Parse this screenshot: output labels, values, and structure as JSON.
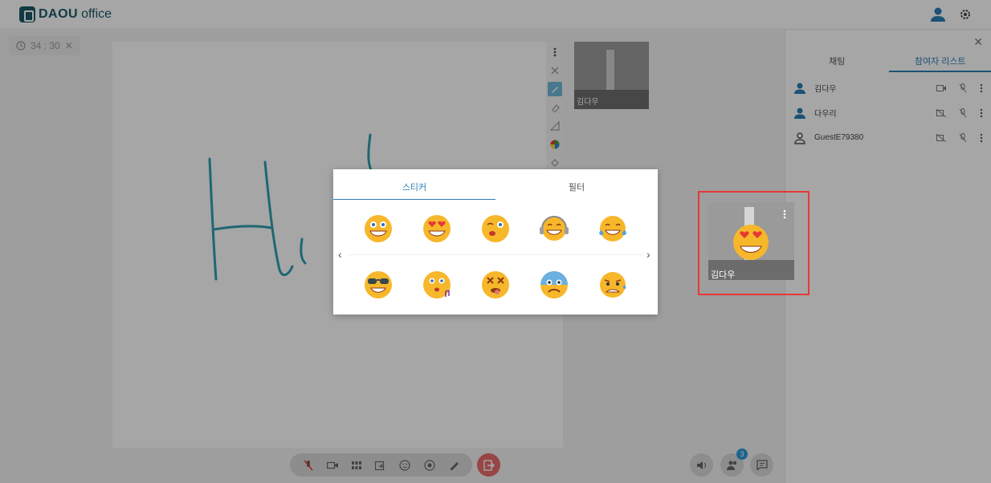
{
  "app": {
    "brand": "DAOU",
    "suffix": "office"
  },
  "timer": {
    "text": "34 : 30"
  },
  "board": {
    "handwriting": "Hi"
  },
  "thumbnail": {
    "name": "김다우"
  },
  "panel": {
    "tabs": [
      "채팅",
      "참여자 리스트"
    ],
    "participants": [
      {
        "name": "김다우"
      },
      {
        "name": "다우리"
      },
      {
        "name": "GuestE79380"
      }
    ]
  },
  "popup": {
    "tabs": [
      "스티커",
      "필터"
    ],
    "stickers": [
      {
        "icon": "grin-face-icon"
      },
      {
        "icon": "heart-eyes-face-icon"
      },
      {
        "icon": "winking-kiss-face-icon"
      },
      {
        "icon": "headphones-face-icon"
      },
      {
        "icon": "tears-of-joy-face-icon"
      },
      {
        "icon": "sunglasses-face-icon"
      },
      {
        "icon": "whistling-face-icon"
      },
      {
        "icon": "dizzy-face-icon"
      },
      {
        "icon": "fearful-face-icon"
      },
      {
        "icon": "sweating-face-icon"
      }
    ]
  },
  "self_preview": {
    "name": "김다우"
  },
  "participant_count": "3",
  "colors": {
    "accent": "#2a7fb5",
    "highlight": "#e53935",
    "pen": "#2f9fb0",
    "leave": "#e86a6a"
  }
}
